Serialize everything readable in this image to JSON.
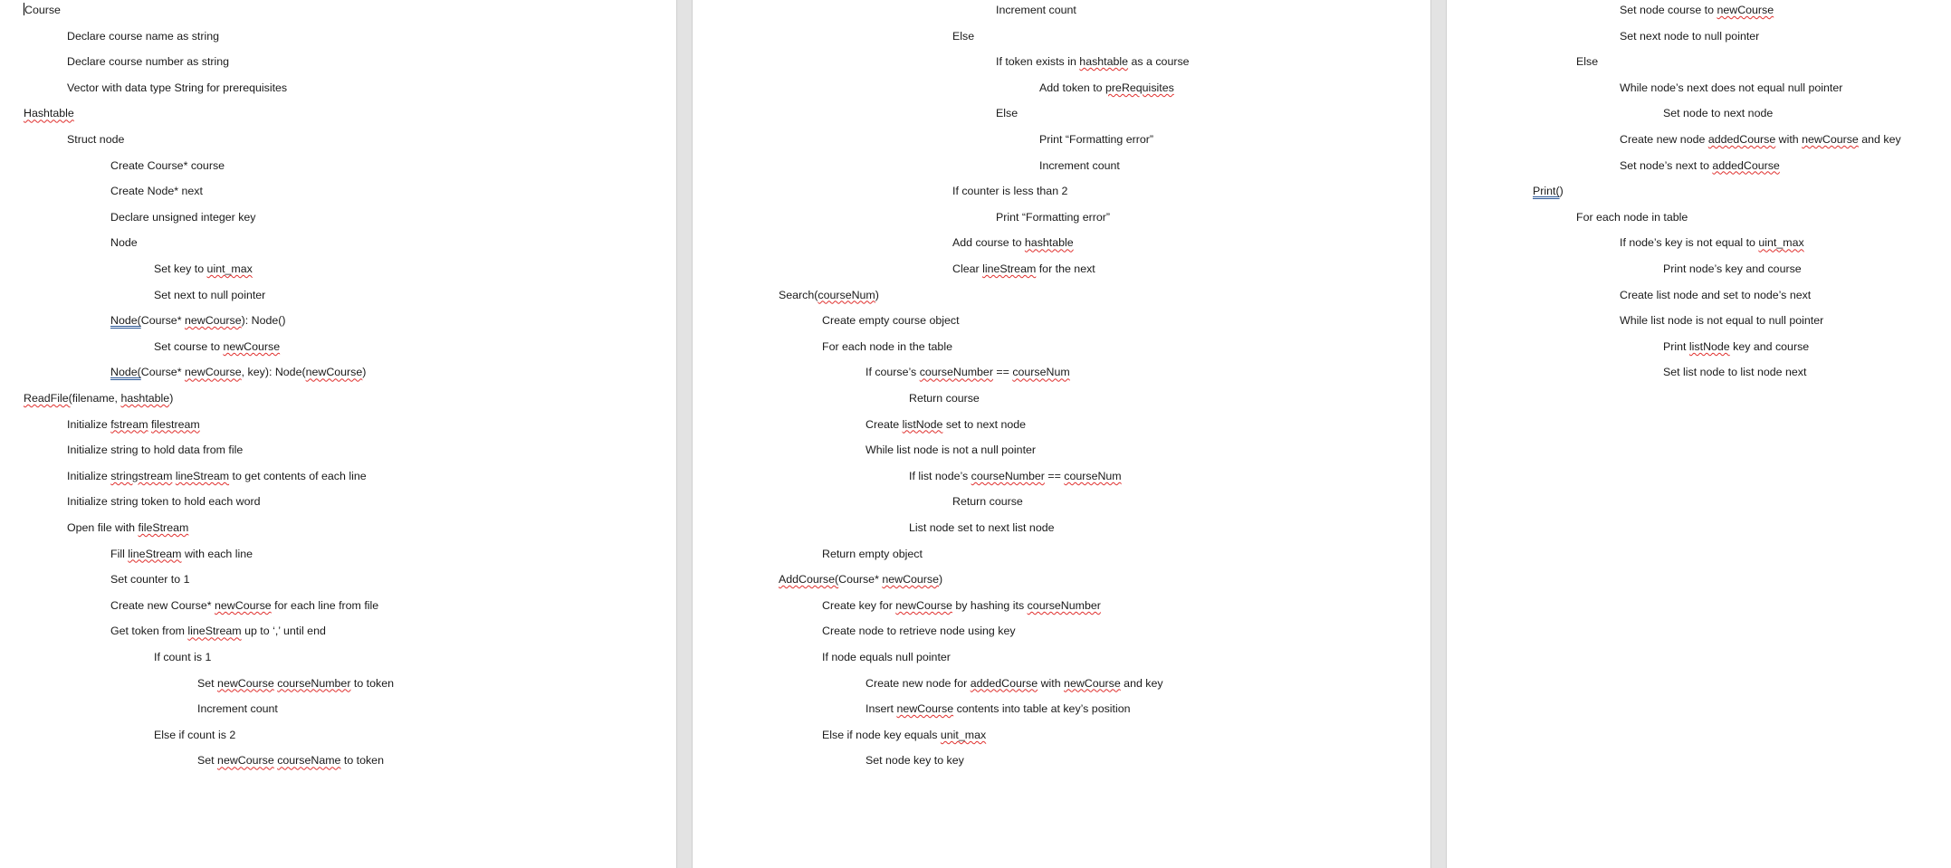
{
  "document": {
    "pages": [
      {
        "lines": [
          {
            "indent": 0,
            "segments": [
              {
                "t": "Course"
              }
            ],
            "cursor": true
          },
          {
            "indent": 1,
            "segments": [
              {
                "t": "Declare course name as string"
              }
            ]
          },
          {
            "indent": 1,
            "segments": [
              {
                "t": "Declare course number as string"
              }
            ]
          },
          {
            "indent": 1,
            "segments": [
              {
                "t": "Vector with data type String for prerequisites"
              }
            ]
          },
          {
            "indent": 0,
            "segments": [
              {
                "t": "Hashtable",
                "s": "sp"
              }
            ]
          },
          {
            "indent": 1,
            "segments": [
              {
                "t": "Struct node"
              }
            ]
          },
          {
            "indent": 2,
            "segments": [
              {
                "t": "Create Course* course"
              }
            ]
          },
          {
            "indent": 2,
            "segments": [
              {
                "t": "Create Node* next"
              }
            ]
          },
          {
            "indent": 2,
            "segments": [
              {
                "t": "Declare unsigned integer key"
              }
            ]
          },
          {
            "indent": 2,
            "segments": [
              {
                "t": "Node"
              }
            ]
          },
          {
            "indent": 3,
            "segments": [
              {
                "t": "Set key to "
              },
              {
                "t": "uint_max",
                "s": "sp"
              }
            ]
          },
          {
            "indent": 3,
            "segments": [
              {
                "t": "Set next to null pointer"
              }
            ]
          },
          {
            "indent": 2,
            "segments": [
              {
                "t": "Node(",
                "s": "gr"
              },
              {
                "t": "Course* "
              },
              {
                "t": "newCourse",
                "s": "sp"
              },
              {
                "t": "): Node()"
              }
            ]
          },
          {
            "indent": 3,
            "segments": [
              {
                "t": "Set course to "
              },
              {
                "t": "newCourse",
                "s": "sp"
              }
            ]
          },
          {
            "indent": 2,
            "segments": [
              {
                "t": "Node(",
                "s": "gr"
              },
              {
                "t": "Course* "
              },
              {
                "t": "newCourse",
                "s": "sp"
              },
              {
                "t": ", key): Node("
              },
              {
                "t": "newCourse",
                "s": "sp"
              },
              {
                "t": ")"
              }
            ]
          },
          {
            "indent": 0,
            "segments": [
              {
                "t": "ReadFile(",
                "s": "sp"
              },
              {
                "t": "filename, "
              },
              {
                "t": "hashtable",
                "s": "sp"
              },
              {
                "t": ")"
              }
            ]
          },
          {
            "indent": 1,
            "segments": [
              {
                "t": "Initialize "
              },
              {
                "t": "fstream",
                "s": "sp"
              },
              {
                "t": " "
              },
              {
                "t": "filestream",
                "s": "sp"
              }
            ]
          },
          {
            "indent": 1,
            "segments": [
              {
                "t": "Initialize string to hold data from file"
              }
            ]
          },
          {
            "indent": 1,
            "segments": [
              {
                "t": "Initialize "
              },
              {
                "t": "stringstream",
                "s": "sp"
              },
              {
                "t": " "
              },
              {
                "t": "lineStream",
                "s": "sp"
              },
              {
                "t": " to get contents of each line"
              }
            ]
          },
          {
            "indent": 1,
            "segments": [
              {
                "t": "Initialize string token to hold each word"
              }
            ]
          },
          {
            "indent": 1,
            "segments": [
              {
                "t": "Open file with "
              },
              {
                "t": "fileStream",
                "s": "sp"
              }
            ]
          },
          {
            "indent": 2,
            "segments": [
              {
                "t": "Fill "
              },
              {
                "t": "lineStream",
                "s": "sp"
              },
              {
                "t": " with each line"
              }
            ]
          },
          {
            "indent": 2,
            "segments": [
              {
                "t": "Set counter to 1"
              }
            ]
          },
          {
            "indent": 2,
            "segments": [
              {
                "t": "Create new Course* "
              },
              {
                "t": "newCourse",
                "s": "sp"
              },
              {
                "t": " for each line from file"
              }
            ]
          },
          {
            "indent": 2,
            "segments": [
              {
                "t": "Get token from "
              },
              {
                "t": "lineStream",
                "s": "sp"
              },
              {
                "t": " up to ‘,’ until end"
              }
            ]
          },
          {
            "indent": 3,
            "segments": [
              {
                "t": "If count is 1"
              }
            ]
          },
          {
            "indent": 4,
            "segments": [
              {
                "t": "Set "
              },
              {
                "t": "newCourse",
                "s": "sp"
              },
              {
                "t": " "
              },
              {
                "t": "courseNumber",
                "s": "sp"
              },
              {
                "t": " to token"
              }
            ]
          },
          {
            "indent": 4,
            "segments": [
              {
                "t": "Increment count"
              }
            ]
          },
          {
            "indent": 3,
            "segments": [
              {
                "t": "Else if count is 2"
              }
            ]
          },
          {
            "indent": 4,
            "segments": [
              {
                "t": "Set "
              },
              {
                "t": "newCourse",
                "s": "sp"
              },
              {
                "t": " "
              },
              {
                "t": "courseName",
                "s": "sp"
              },
              {
                "t": " to token"
              }
            ]
          }
        ]
      },
      {
        "lines": [
          {
            "indent": 5,
            "segments": [
              {
                "t": "Increment count"
              }
            ]
          },
          {
            "indent": 4,
            "segments": [
              {
                "t": "Else"
              }
            ]
          },
          {
            "indent": 5,
            "segments": [
              {
                "t": "If token exists in "
              },
              {
                "t": "hashtable",
                "s": "sp"
              },
              {
                "t": " as a course"
              }
            ]
          },
          {
            "indent": 6,
            "segments": [
              {
                "t": "Add token to "
              },
              {
                "t": "preRequisites",
                "s": "sp"
              }
            ]
          },
          {
            "indent": 5,
            "segments": [
              {
                "t": "Else"
              }
            ]
          },
          {
            "indent": 6,
            "segments": [
              {
                "t": "Print “Formatting error”"
              }
            ]
          },
          {
            "indent": 6,
            "segments": [
              {
                "t": "Increment count"
              }
            ]
          },
          {
            "indent": 4,
            "segments": [
              {
                "t": "If counter is less than 2"
              }
            ]
          },
          {
            "indent": 5,
            "segments": [
              {
                "t": "Print “Formatting error”"
              }
            ]
          },
          {
            "indent": 4,
            "segments": [
              {
                "t": "Add course to "
              },
              {
                "t": "hashtable",
                "s": "sp"
              }
            ]
          },
          {
            "indent": 4,
            "segments": [
              {
                "t": "Clear "
              },
              {
                "t": "lineStream",
                "s": "sp"
              },
              {
                "t": " for the next"
              }
            ]
          },
          {
            "indent": 0,
            "segments": [
              {
                "t": "Search("
              },
              {
                "t": "courseNum",
                "s": "sp"
              },
              {
                "t": ")"
              }
            ]
          },
          {
            "indent": 1,
            "segments": [
              {
                "t": "Create empty course object"
              }
            ]
          },
          {
            "indent": 1,
            "segments": [
              {
                "t": "For each node in the table"
              }
            ]
          },
          {
            "indent": 2,
            "segments": [
              {
                "t": "If course’s "
              },
              {
                "t": "courseNumber",
                "s": "sp"
              },
              {
                "t": " == "
              },
              {
                "t": "courseNum",
                "s": "sp"
              }
            ]
          },
          {
            "indent": 3,
            "segments": [
              {
                "t": "Return course"
              }
            ]
          },
          {
            "indent": 2,
            "segments": [
              {
                "t": "Create "
              },
              {
                "t": "listNode",
                "s": "sp"
              },
              {
                "t": " set to next node"
              }
            ]
          },
          {
            "indent": 2,
            "segments": [
              {
                "t": "While list node is not a null pointer"
              }
            ]
          },
          {
            "indent": 3,
            "segments": [
              {
                "t": "If list node’s "
              },
              {
                "t": "courseNumber",
                "s": "sp"
              },
              {
                "t": " == "
              },
              {
                "t": "courseNum",
                "s": "sp"
              }
            ]
          },
          {
            "indent": 4,
            "segments": [
              {
                "t": "Return course"
              }
            ]
          },
          {
            "indent": 3,
            "segments": [
              {
                "t": "List node set to next list node"
              }
            ]
          },
          {
            "indent": 1,
            "segments": [
              {
                "t": "Return empty object"
              }
            ]
          },
          {
            "indent": 0,
            "segments": [
              {
                "t": "AddCourse(",
                "s": "sp"
              },
              {
                "t": "Course* "
              },
              {
                "t": "newCourse",
                "s": "sp"
              },
              {
                "t": ")"
              }
            ]
          },
          {
            "indent": 1,
            "segments": [
              {
                "t": "Create key for "
              },
              {
                "t": "newCourse",
                "s": "sp"
              },
              {
                "t": " by hashing its "
              },
              {
                "t": "courseNumber",
                "s": "sp"
              }
            ]
          },
          {
            "indent": 1,
            "segments": [
              {
                "t": "Create node to retrieve node using key"
              }
            ]
          },
          {
            "indent": 1,
            "segments": [
              {
                "t": "If node equals null pointer"
              }
            ]
          },
          {
            "indent": 2,
            "segments": [
              {
                "t": "Create new node for "
              },
              {
                "t": "addedCourse",
                "s": "sp"
              },
              {
                "t": " with "
              },
              {
                "t": "newCourse",
                "s": "sp"
              },
              {
                "t": " and key"
              }
            ]
          },
          {
            "indent": 2,
            "segments": [
              {
                "t": "Insert "
              },
              {
                "t": "newCourse",
                "s": "sp"
              },
              {
                "t": " contents into table at key’s position"
              }
            ]
          },
          {
            "indent": 1,
            "segments": [
              {
                "t": "Else if node key equals "
              },
              {
                "t": "unit_max",
                "s": "sp"
              }
            ]
          },
          {
            "indent": 2,
            "segments": [
              {
                "t": "Set node key to key"
              }
            ]
          }
        ]
      },
      {
        "lines": [
          {
            "indent": 2,
            "segments": [
              {
                "t": "Set node course to "
              },
              {
                "t": "newCourse",
                "s": "sp"
              }
            ]
          },
          {
            "indent": 2,
            "segments": [
              {
                "t": "Set next node to null pointer"
              }
            ]
          },
          {
            "indent": 1,
            "segments": [
              {
                "t": "Else"
              }
            ]
          },
          {
            "indent": 2,
            "segments": [
              {
                "t": "While node’s next does not equal null pointer"
              }
            ]
          },
          {
            "indent": 3,
            "segments": [
              {
                "t": "Set node to next node"
              }
            ]
          },
          {
            "indent": 2,
            "segments": [
              {
                "t": "Create new node "
              },
              {
                "t": "addedCourse",
                "s": "sp"
              },
              {
                "t": " with "
              },
              {
                "t": "newCourse",
                "s": "sp"
              },
              {
                "t": " and key"
              }
            ]
          },
          {
            "indent": 2,
            "segments": [
              {
                "t": "Set node’s next to "
              },
              {
                "t": "addedCourse",
                "s": "sp"
              }
            ]
          },
          {
            "indent": 0,
            "segments": [
              {
                "t": "Print(",
                "s": "gr"
              },
              {
                "t": ")"
              }
            ]
          },
          {
            "indent": 1,
            "segments": [
              {
                "t": "For each node in table"
              }
            ]
          },
          {
            "indent": 2,
            "segments": [
              {
                "t": "If node’s key is not equal to "
              },
              {
                "t": "uint_max",
                "s": "sp"
              }
            ]
          },
          {
            "indent": 3,
            "segments": [
              {
                "t": "Print node’s key and course"
              }
            ]
          },
          {
            "indent": 2,
            "segments": [
              {
                "t": "Create list node and set to node’s next"
              }
            ]
          },
          {
            "indent": 2,
            "segments": [
              {
                "t": "While list node is not equal to null pointer"
              }
            ]
          },
          {
            "indent": 3,
            "segments": [
              {
                "t": "Print "
              },
              {
                "t": "listNode",
                "s": "sp"
              },
              {
                "t": " key and course"
              }
            ]
          },
          {
            "indent": 3,
            "segments": [
              {
                "t": "Set list node to list node next"
              }
            ]
          }
        ]
      }
    ]
  }
}
